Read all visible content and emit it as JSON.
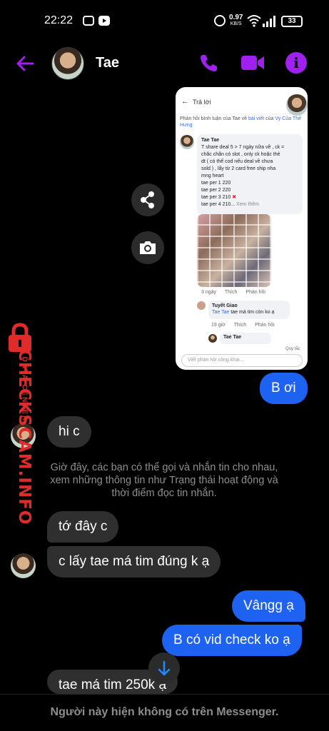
{
  "status_bar": {
    "time": "22:22",
    "net_speed": "0.97",
    "net_unit": "KB/S",
    "battery": "33"
  },
  "header": {
    "contact_name": "Tae",
    "accent_color": "#a020f0"
  },
  "shared_image": {
    "title": "Trả lời",
    "caption_prefix": "Phản hồi bình luận của Tae về",
    "caption_link1": "bài viết",
    "caption_mid": "của",
    "caption_link2": "Vy Của Thế Hưng",
    "comment_name": "Tae Tae",
    "comment_lines": [
      "T share deal 5 > 7 ngày nữa về , ck =",
      "chắc chắn có slot , only ck hoặc thẻ",
      "dt ( có thể cod nếu deal về chưa",
      "sold ) , lấy từ 2 card free ship nha",
      "mng heart",
      "tae per 1 220",
      "tae per 2 220"
    ],
    "comment_line_x": "tae per 3 210",
    "comment_line_last": "tae per 4 210...",
    "see_more": "Xem thêm",
    "meta_time": "3 ngày",
    "meta_like": "Thích",
    "meta_reply": "Phản hồi",
    "reply_name": "Tuyết Giao",
    "reply_tag": "Tae Tae",
    "reply_text": "tae má tim còn ko ạ",
    "reply_meta_time": "19 giờ",
    "reply_meta_like": "Thích",
    "reply_meta_reply": "Phản hồi",
    "reply2_name": "Tae Tae",
    "rules": "Quy tắc",
    "input_placeholder": "Viết phản hồi công khai..."
  },
  "messages": {
    "out_1": "B ơi",
    "in_1": "hi c",
    "system_note": "Giờ đây, các bạn có thể gọi và nhắn tin cho nhau, xem những thông tin như Trạng thái hoạt động và thời điểm đọc tin nhắn.",
    "in_2": "tớ đây c",
    "in_3": "c lấy tae má tim đúng k ạ",
    "out_2": "Vângg ạ",
    "out_3": "B có vid check ko ạ",
    "in_4": "tae má tim 250k ạ"
  },
  "watermark": {
    "big": "CHECKSCAM.INFO",
    "small": "DATA CENTER",
    "color": "#e02b2b"
  },
  "footer": {
    "notice": "Người này hiện không có trên Messenger."
  },
  "icons": [
    "back-arrow-icon",
    "phone-icon",
    "video-icon",
    "info-icon",
    "share-icon",
    "camera-icon",
    "chevron-down-icon",
    "lock-icon"
  ]
}
